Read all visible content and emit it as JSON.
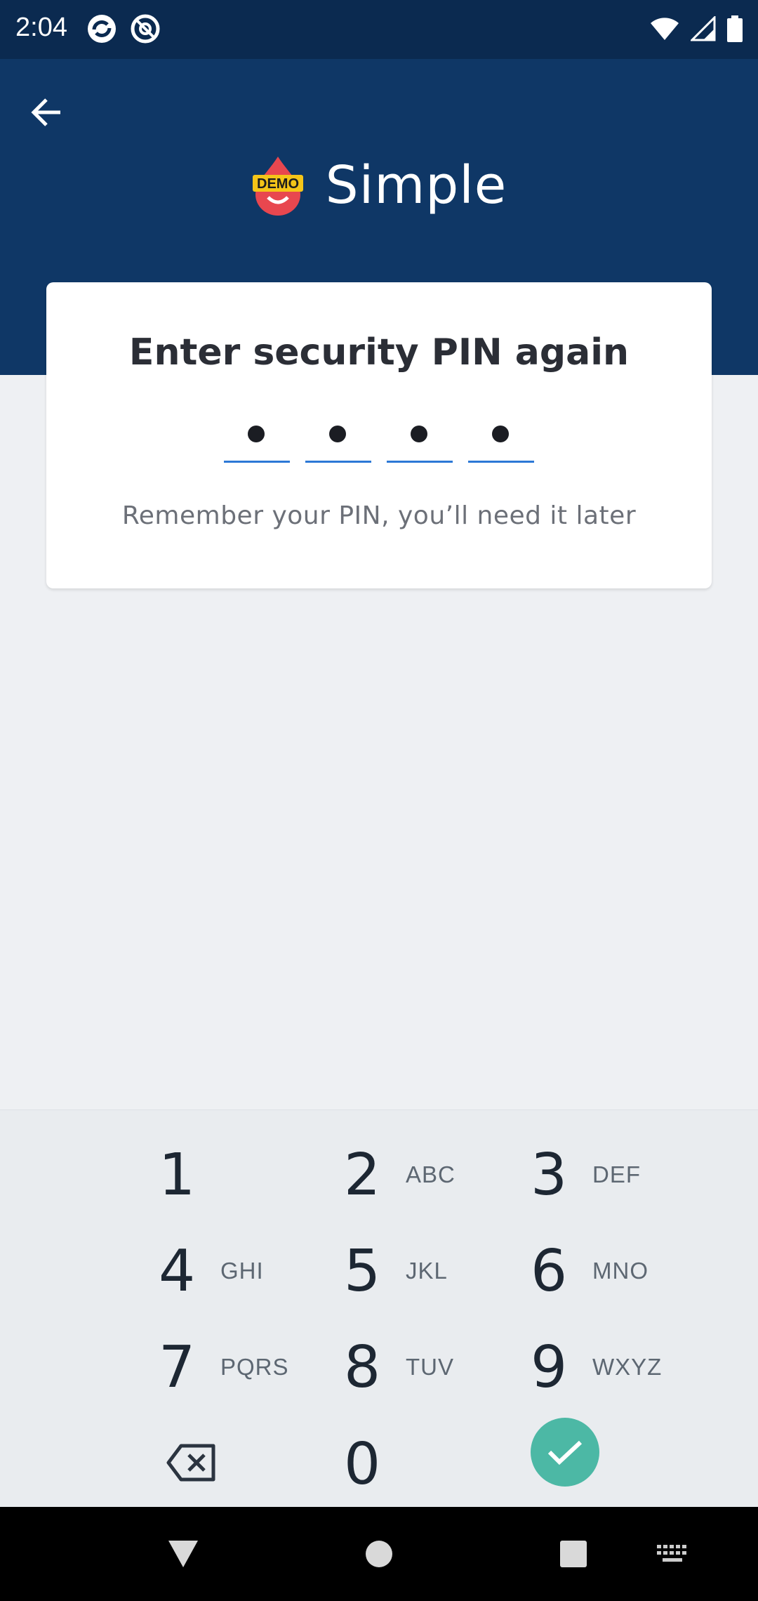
{
  "status_bar": {
    "time": "2:04",
    "icons": [
      "sync-icon",
      "data-saver-icon",
      "wifi-icon",
      "signal-icon",
      "battery-icon"
    ]
  },
  "header": {
    "back_icon": "arrow-left-icon",
    "logo_badge": "DEMO",
    "app_name": "Simple",
    "colors": {
      "header_bg": "#0f3766",
      "status_bg": "#0b2a50",
      "logo_drop": "#e8474f",
      "logo_badge": "#f5c518"
    }
  },
  "card": {
    "title": "Enter security PIN again",
    "pin_length": 4,
    "pin_filled": 4,
    "hint": "Remember your PIN, you’ll need it later",
    "underline_color": "#2c78d6"
  },
  "keypad": {
    "keys": [
      {
        "num": "1",
        "letters": ""
      },
      {
        "num": "2",
        "letters": "ABC"
      },
      {
        "num": "3",
        "letters": "DEF"
      },
      {
        "num": "4",
        "letters": "GHI"
      },
      {
        "num": "5",
        "letters": "JKL"
      },
      {
        "num": "6",
        "letters": "MNO"
      },
      {
        "num": "7",
        "letters": "PQRS"
      },
      {
        "num": "8",
        "letters": "TUV"
      },
      {
        "num": "9",
        "letters": "WXYZ"
      },
      {
        "num": "0",
        "letters": ""
      }
    ],
    "backspace_icon": "backspace-icon",
    "done_icon": "check-icon",
    "done_color": "#4cb8a5"
  },
  "nav_bar": {
    "icons": [
      "back-triangle-icon",
      "home-circle-icon",
      "recents-square-icon",
      "keyboard-icon"
    ]
  }
}
